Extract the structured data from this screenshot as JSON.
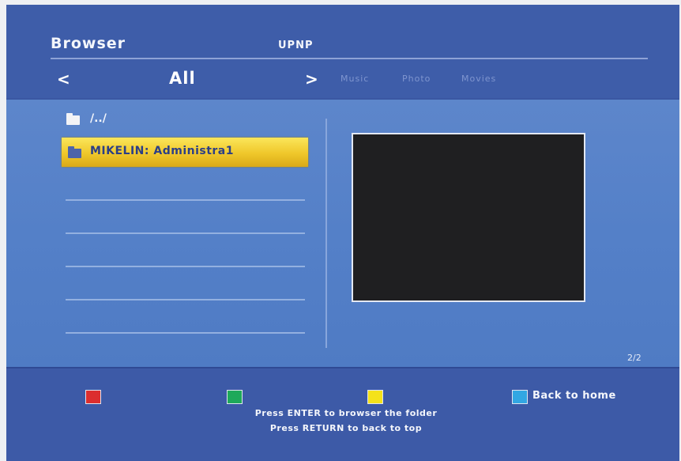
{
  "header": {
    "title": "Browser",
    "source": "UPNP",
    "nav": {
      "prev": "<",
      "current": "All",
      "next": ">",
      "categories": [
        "Music",
        "Photo",
        "Movies"
      ]
    }
  },
  "list": {
    "parent": "/../",
    "items": [
      "MIKELIN: Administra1"
    ],
    "selected_index": 0
  },
  "preview": {
    "background_color": "#1f1f21"
  },
  "page_counter": "2/2",
  "footer": {
    "keys": {
      "red": {
        "color": "#dc2e2e",
        "label": ""
      },
      "green": {
        "color": "#1ea95a",
        "label": ""
      },
      "yellow": {
        "color": "#f4e21a",
        "label": ""
      },
      "blue": {
        "color": "#32a7e3",
        "label": "Back to home"
      }
    },
    "hints": [
      "Press ENTER to browser the folder",
      "Press RETURN to back to top"
    ]
  },
  "colors": {
    "background": "#3c5aa6",
    "highlight": "#efc72a",
    "text": "#f4f6fb"
  }
}
